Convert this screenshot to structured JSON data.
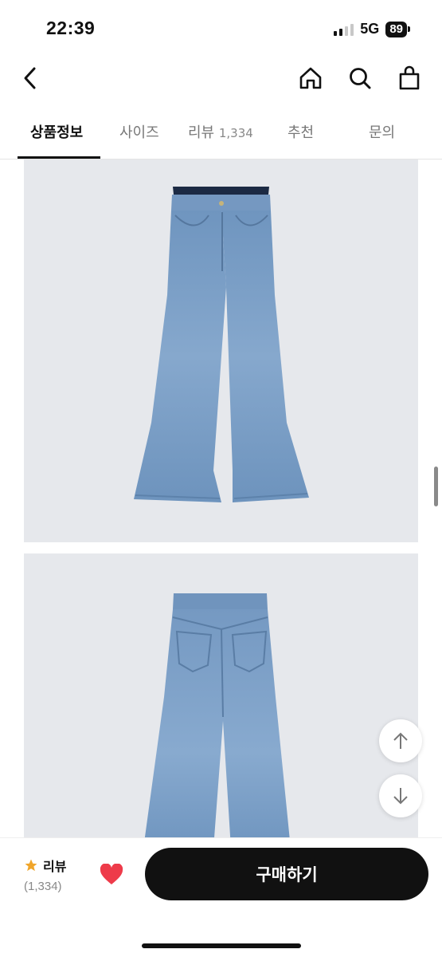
{
  "status_bar": {
    "time": "22:39",
    "network": "5G",
    "battery": "89"
  },
  "top_nav": {
    "back_icon": "chevron-left-icon",
    "home_icon": "home-icon",
    "search_icon": "search-icon",
    "cart_icon": "shopping-bag-icon"
  },
  "tabs": [
    {
      "label": "상품정보",
      "active": true
    },
    {
      "label": "사이즈",
      "active": false
    },
    {
      "label": "리뷰",
      "count": "1,334",
      "active": false
    },
    {
      "label": "추천",
      "active": false
    },
    {
      "label": "문의",
      "active": false
    }
  ],
  "images": [
    {
      "view": "front",
      "subject": "jeans"
    },
    {
      "view": "back",
      "subject": "jeans"
    }
  ],
  "float_buttons": {
    "up_icon": "arrow-up-icon",
    "down_icon": "arrow-down-icon"
  },
  "bottom_bar": {
    "review_label": "리뷰",
    "review_count": "(1,334)",
    "star_color": "#f0a52a",
    "heart_color": "#ee3b4a",
    "buy_label": "구매하기"
  }
}
